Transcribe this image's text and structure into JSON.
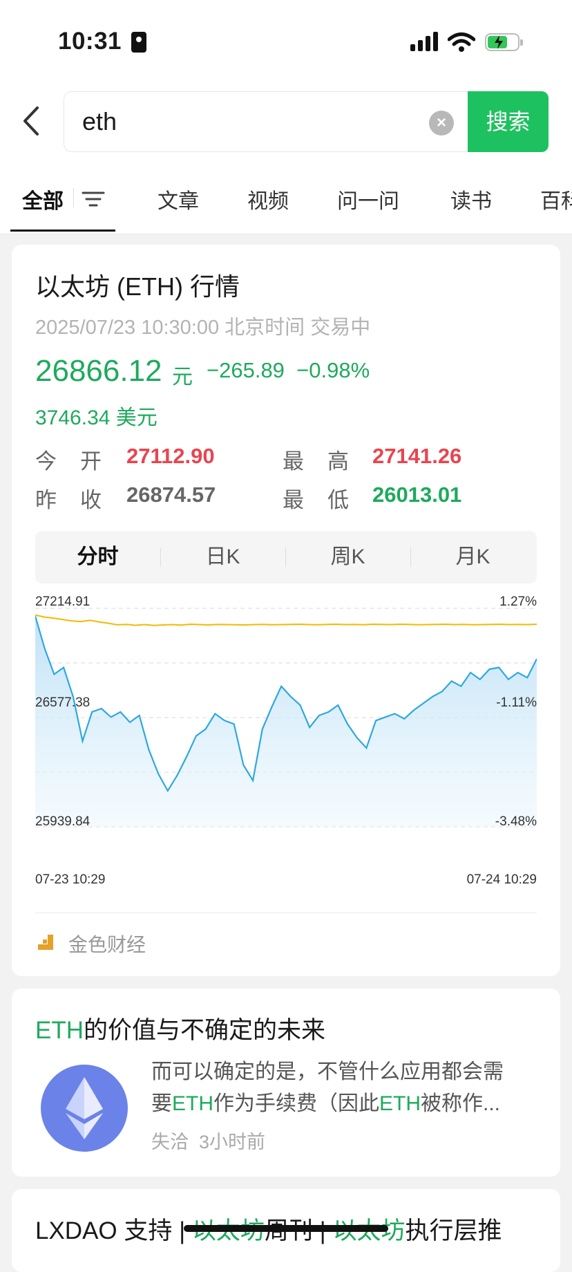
{
  "status_bar": {
    "time": "10:31"
  },
  "search": {
    "query": "eth",
    "button_label": "搜索"
  },
  "tabs": [
    {
      "label": "全部"
    },
    {
      "label": "文章"
    },
    {
      "label": "视频"
    },
    {
      "label": "问一问"
    },
    {
      "label": "读书"
    },
    {
      "label": "百科"
    }
  ],
  "market_card": {
    "title": "以太坊 (ETH) 行情",
    "datetime": "2025/07/23 10:30:00 北京时间 交易中",
    "price": "26866.12",
    "price_unit": "元",
    "change": "−265.89",
    "change_pct": "−0.98%",
    "usd_price": "3746.34 美元",
    "open_label": "今开",
    "open_value": "27112.90",
    "high_label": "最高",
    "high_value": "27141.26",
    "prev_close_label": "昨收",
    "prev_close_value": "26874.57",
    "low_label": "最低",
    "low_value": "26013.01",
    "periods": [
      "分时",
      "日K",
      "周K",
      "月K"
    ],
    "source": "金色财经"
  },
  "chart_data": {
    "type": "line",
    "title": "",
    "ylim": [
      25939.84,
      27214.91
    ],
    "y_tick_labels": [
      "27214.91",
      "26577.38",
      "25939.84"
    ],
    "right_tick_labels": [
      "1.27%",
      "-1.11%",
      "-3.48%"
    ],
    "x_tick_labels": [
      "07-23 10:29",
      "07-24 10:29"
    ],
    "x": [
      0,
      0.01,
      0.03,
      0.05,
      0.07,
      0.09,
      0.1,
      0.11,
      0.13,
      0.15,
      0.16,
      0.18,
      0.2,
      0.22,
      0.24,
      0.25,
      0.27,
      0.29,
      0.3,
      0.32,
      0.34,
      0.36,
      0.38,
      0.4,
      0.42,
      0.44,
      0.46,
      0.47,
      0.48,
      0.5,
      0.52,
      0.53,
      0.55,
      0.57,
      0.58,
      0.6,
      0.62,
      0.64,
      0.66,
      0.67,
      0.69,
      0.7,
      0.72,
      0.74,
      0.76,
      0.78,
      0.8,
      0.82,
      0.84,
      0.86,
      0.88,
      0.9,
      0.91,
      0.93,
      0.95,
      0.97,
      0.99,
      1.0
    ],
    "series": [
      {
        "color": "#2ea7e0",
        "values": [
          27170,
          26980,
          26830,
          26870,
          26700,
          26440,
          26610,
          26630,
          26580,
          26610,
          26550,
          26590,
          26390,
          26250,
          26150,
          26240,
          26350,
          26470,
          26510,
          26600,
          26560,
          26540,
          26300,
          26210,
          26510,
          26640,
          26760,
          26700,
          26650,
          26520,
          26590,
          26610,
          26650,
          26540,
          26460,
          26400,
          26560,
          26580,
          26600,
          26570,
          26620,
          26660,
          26700,
          26730,
          26790,
          26760,
          26840,
          26800,
          26860,
          26870,
          26800,
          26840,
          26810,
          26920
        ]
      },
      {
        "color": "#f5b800",
        "values": [
          27176,
          27164,
          27158,
          27150,
          27142,
          27138,
          27145,
          27136,
          27128,
          27119,
          27121,
          27116,
          27120,
          27115,
          27118,
          27120,
          27117,
          27122,
          27120,
          27118,
          27121,
          27120,
          27119,
          27118,
          27120,
          27121,
          27119,
          27120,
          27121,
          27122,
          27120,
          27119,
          27121,
          27122,
          27120,
          27121,
          27119,
          27122,
          27121,
          27120,
          27122,
          27121,
          27119,
          27120,
          27121,
          27122,
          27120,
          27121,
          27119,
          27120,
          27121,
          27122,
          27120,
          27121,
          27120,
          27122
        ]
      }
    ]
  },
  "article1": {
    "title_hl": "ETH",
    "title_rest": "的价值与不确定的未来",
    "line1": "而可以确定的是，不管什么应用都会需",
    "line2_a": "要",
    "line2_b": "ETH",
    "line2_c": "作为手续费（因此",
    "line2_d": "ETH",
    "line2_e": "被称作...",
    "author": "失洽",
    "time": "3小时前"
  },
  "article2": {
    "a": "LXDAO 支持 | ",
    "b": "以太坊",
    "c": "周刊 | ",
    "d": "以太坊",
    "e": "执行层推"
  }
}
